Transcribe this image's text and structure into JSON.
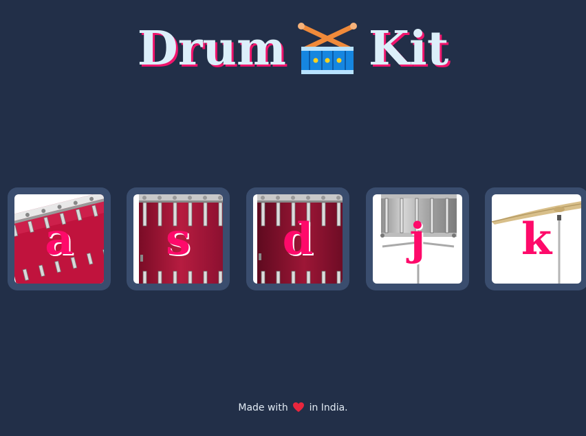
{
  "header": {
    "title_left": "Drum",
    "title_right": "Kit",
    "emoji_icon": "drum-emoji-icon"
  },
  "keys": [
    {
      "letter": "a",
      "instrument": "tom-drum"
    },
    {
      "letter": "s",
      "instrument": "floor-tom-drum"
    },
    {
      "letter": "d",
      "instrument": "bass-drum"
    },
    {
      "letter": "j",
      "instrument": "snare-drum"
    },
    {
      "letter": "k",
      "instrument": "crash-cymbal"
    }
  ],
  "footer": {
    "made_with": "Made with",
    "in_india": "in India.",
    "heart_icon": "heart-icon"
  },
  "colors": {
    "background": "#222f48",
    "key_frame": "#3a4d6e",
    "accent": "#fe0a6a",
    "title_text": "#dceffa"
  }
}
